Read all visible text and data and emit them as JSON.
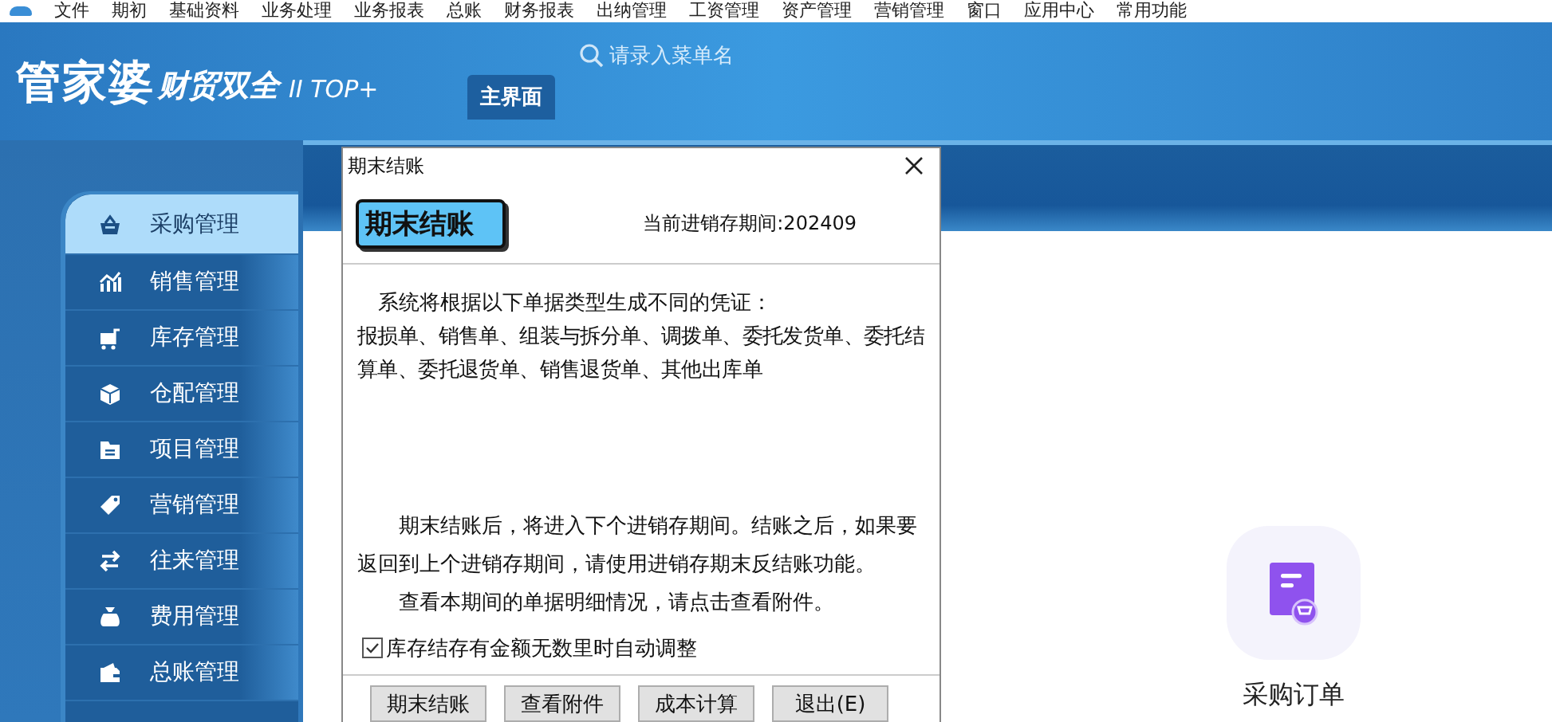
{
  "menu_bar": {
    "items": [
      "文件",
      "期初",
      "基础资料",
      "业务处理",
      "业务报表",
      "总账",
      "财务报表",
      "出纳管理",
      "工资管理",
      "资产管理",
      "营销管理",
      "窗口",
      "应用中心",
      "常用功能"
    ]
  },
  "header": {
    "logo": "管家婆",
    "product": "财贸双全",
    "edition": "II TOP+",
    "search": {
      "placeholder": "请录入菜单名"
    },
    "tabs": [
      {
        "label": "主界面",
        "selected": true
      }
    ]
  },
  "sidebar": {
    "items": [
      {
        "label": "采购管理",
        "selected": true
      },
      {
        "label": "销售管理",
        "selected": false
      },
      {
        "label": "库存管理",
        "selected": false
      },
      {
        "label": "仓配管理",
        "selected": false
      },
      {
        "label": "项目管理",
        "selected": false
      },
      {
        "label": "营销管理",
        "selected": false
      },
      {
        "label": "往来管理",
        "selected": false
      },
      {
        "label": "费用管理",
        "selected": false
      },
      {
        "label": "总账管理",
        "selected": false
      }
    ]
  },
  "content": {
    "tiles": [
      {
        "label": "采购订单"
      }
    ]
  },
  "dialog": {
    "title": "期末结账",
    "heading": "期末结账",
    "period": "当前进销存期间:202409",
    "paragraphs": [
      {
        "kind": "lead",
        "text": "系统将根据以下单据类型生成不同的凭证："
      },
      {
        "kind": "list",
        "text": "报损单、销售单、组装与拆分单、调拨单、委托发货单、委托结算单、委托退货单、销售退货单、其他出库单"
      },
      {
        "kind": "note",
        "text": "期末结账后，将进入下个进销存期间。结账之后，如果要返回到上个进销存期间，请使用进销存期末反结账功能。"
      },
      {
        "kind": "note",
        "text": "查看本期间的单据明细情况，请点击查看附件。"
      }
    ],
    "checkbox": {
      "label": "库存结存有金额无数里时自动调整",
      "checked": true
    },
    "buttons": [
      "期末结账",
      "查看附件",
      "成本计算",
      "退出(E)"
    ]
  }
}
